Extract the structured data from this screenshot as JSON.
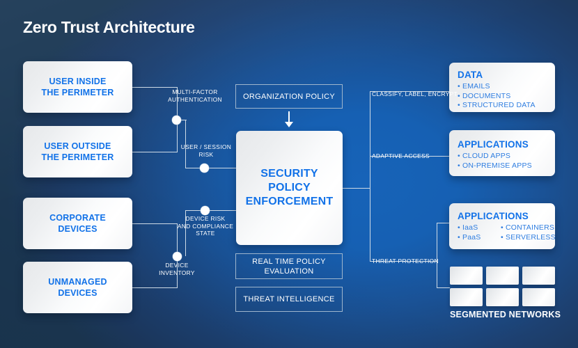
{
  "page": {
    "title": "Zero Trust Architecture",
    "background_dark": "#1d4568",
    "background_bright": "#1763b8",
    "accent_blue": "#1272e8",
    "line_color": "#cfdbe6"
  },
  "sources": [
    {
      "line1": "USER INSIDE",
      "line2": "THE PERIMETER"
    },
    {
      "line1": "USER OUTSIDE",
      "line2": "THE PERIMETER"
    },
    {
      "line1": "CORPORATE",
      "line2": "DEVICES"
    },
    {
      "line1": "UNMANAGED",
      "line2": "DEVICES"
    }
  ],
  "signals": [
    {
      "id": "mfa",
      "line1": "MULTI-FACTOR",
      "line2": "AUTHENTICATION",
      "line3": ""
    },
    {
      "id": "user-session",
      "line1": "USER / SESSION",
      "line2": "RISK",
      "line3": ""
    },
    {
      "id": "device-risk",
      "line1": "DEVICE RISK",
      "line2": "AND COMPLIANCE",
      "line3": "STATE"
    },
    {
      "id": "device-inventory",
      "line1": "DEVICE",
      "line2": "INVENTORY",
      "line3": ""
    }
  ],
  "organization_policy": {
    "label": "ORGANIZATION POLICY"
  },
  "enforcement": {
    "line1": "SECURITY",
    "line2": "POLICY",
    "line3": "ENFORCEMENT"
  },
  "policy_inputs": [
    {
      "line1": "REAL TIME POLICY",
      "line2": "EVALUATION"
    },
    {
      "line1": "THREAT INTELLIGENCE",
      "line2": ""
    }
  ],
  "enforcement_actions": [
    {
      "id": "classify",
      "label": "CLASSIFY, LABEL, ENCRYPT"
    },
    {
      "id": "adaptive",
      "label": "ADAPTIVE ACCESS"
    },
    {
      "id": "threat",
      "label": "THREAT PROTECTION"
    }
  ],
  "resources": [
    {
      "id": "data",
      "title": "DATA",
      "columns": [
        {
          "items": [
            "• EMAILS",
            "• DOCUMENTS",
            "• STRUCTURED DATA"
          ]
        }
      ]
    },
    {
      "id": "applications-cloud",
      "title": "APPLICATIONS",
      "columns": [
        {
          "items": [
            "• CLOUD APPS",
            "• ON-PREMISE APPS"
          ]
        }
      ]
    },
    {
      "id": "applications-workloads",
      "title": "APPLICATIONS",
      "columns": [
        {
          "items": [
            "• IaaS",
            "• PaaS"
          ]
        },
        {
          "items": [
            "• CONTAINERS",
            "• SERVERLESS"
          ]
        }
      ]
    }
  ],
  "segmented_networks": {
    "caption": "SEGMENTED NETWORKS",
    "tile_count": 6
  }
}
